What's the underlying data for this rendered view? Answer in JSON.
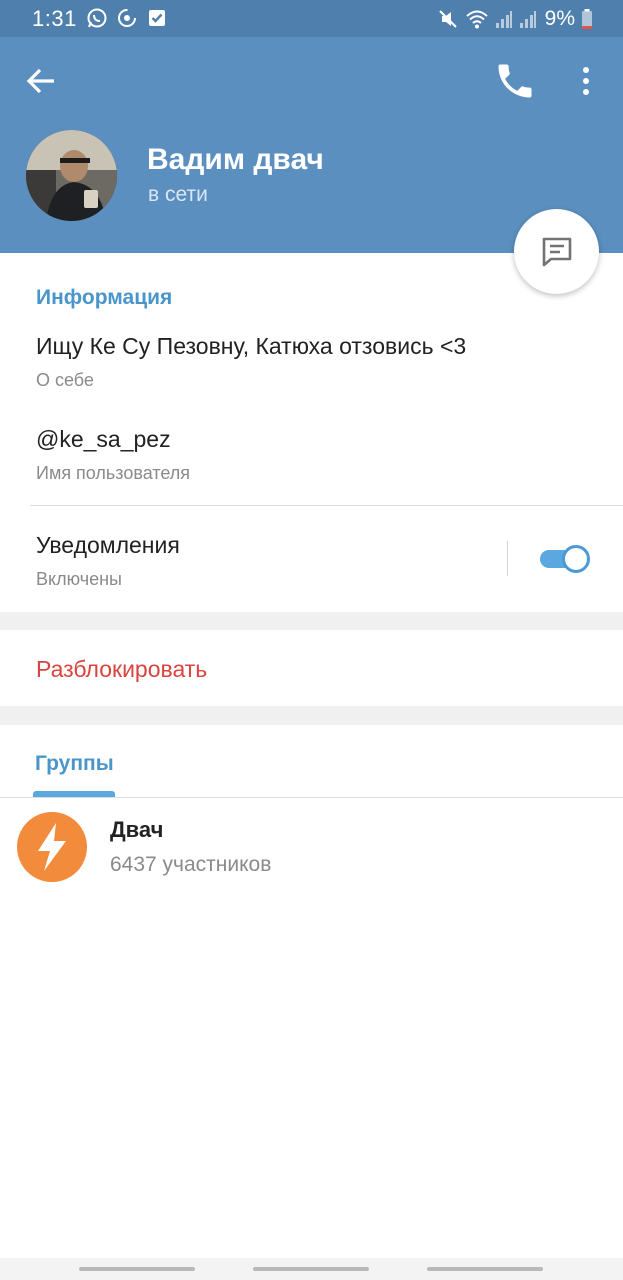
{
  "status_bar": {
    "time": "1:31",
    "battery": "9%",
    "left_icons": [
      "whatsapp-icon",
      "sync-icon",
      "checkbox-icon"
    ],
    "right_icons": [
      "mute-icon",
      "wifi-icon",
      "signal-icon",
      "signal-icon",
      "battery-icon"
    ]
  },
  "header": {
    "name": "Вадим двач",
    "status": "в сети",
    "color": "#5b8fbf"
  },
  "info": {
    "section_title": "Информация",
    "bio_value": "Ищу Ке Су Пезовну, Катюха отзовись <3",
    "bio_caption": "О себе",
    "username_value": "@ke_sa_pez",
    "username_caption": "Имя пользователя",
    "notifications_value": "Уведомления",
    "notifications_caption": "Включены",
    "notifications_on": true
  },
  "actions": {
    "unblock": "Разблокировать",
    "unblock_color": "#d9443f"
  },
  "groups": {
    "tab_label": "Группы",
    "items": [
      {
        "name": "Двач",
        "members": "6437 участников",
        "avatar_color": "#f28c3c"
      }
    ]
  },
  "accent_color": "#4a95c9"
}
